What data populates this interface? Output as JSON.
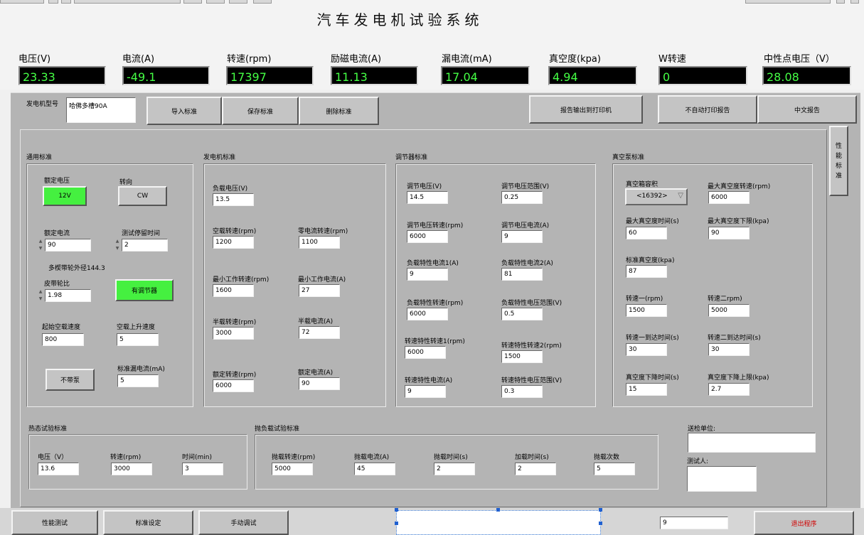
{
  "app": {
    "title": "汽车发电机试验系统"
  },
  "meters": [
    {
      "label": "电压(V)",
      "value": "23.33"
    },
    {
      "label": "电流(A)",
      "value": "-49.1"
    },
    {
      "label": "转速(rpm)",
      "value": "17397"
    },
    {
      "label": "励磁电流(A)",
      "value": "11.13"
    },
    {
      "label": "漏电流(mA)",
      "value": "17.04"
    },
    {
      "label": "真空度(kpa)",
      "value": "4.94"
    },
    {
      "label": "W转速",
      "value": "0"
    },
    {
      "label": "中性点电压（V）",
      "value": "28.08"
    }
  ],
  "model": {
    "label": "发电机型号",
    "value": "哈佛多槽90A"
  },
  "toolbar": {
    "import": "导入标准",
    "save": "保存标准",
    "delete": "删除标准",
    "print_report": "报告输出到打印机",
    "auto_print": "不自动打印报告",
    "chinese_report": "中文报告"
  },
  "side_tab": "性能标准",
  "general": {
    "title": "通用标准",
    "rated_voltage_label": "额定电压",
    "rated_voltage_btn": "12V",
    "direction_label": "转向",
    "direction_btn": "CW",
    "rated_current_label": "额定电流",
    "rated_current": "90",
    "dwell_label": "测试停留时间",
    "dwell": "2",
    "pulley_note": "多楔带轮外径144.3",
    "belt_ratio_label": "皮带轮比",
    "belt_ratio": "1.98",
    "regulator_btn": "有调节器",
    "start_speed_label": "起始空载速度",
    "start_speed": "800",
    "rise_speed_label": "空载上升速度",
    "rise_speed": "5",
    "pump_btn": "不带泵",
    "leak_label": "标准漏电流(mA)",
    "leak": "5"
  },
  "generator": {
    "title": "发电机标准",
    "load_voltage_label": "负载电压(V)",
    "load_voltage": "13.5",
    "idle_speed_label": "空载转速(rpm)",
    "idle_speed": "1200",
    "zero_speed_label": "零电流转速(rpm)",
    "zero_speed": "1100",
    "min_speed_label": "最小工作转速(rpm)",
    "min_speed": "1600",
    "min_current_label": "最小工作电流(A)",
    "min_current": "27",
    "half_speed_label": "半载转速(rpm)",
    "half_speed": "3000",
    "half_current_label": "半载电流(A)",
    "half_current": "72",
    "rated_speed_label": "额定转速(rpm)",
    "rated_speed": "6000",
    "rated_current_label": "额定电流(A)",
    "rated_current": "90"
  },
  "regulator": {
    "title": "调节器标准",
    "reg_voltage_label": "调节电压(V)",
    "reg_voltage": "14.5",
    "reg_range_label": "调节电压范围(V)",
    "reg_range": "0.25",
    "reg_speed_label": "调节电压转速(rpm)",
    "reg_speed": "6000",
    "reg_current_label": "调节电压电流(A)",
    "reg_current": "9",
    "load_cur1_label": "负载特性电流1(A)",
    "load_cur1": "9",
    "load_cur2_label": "负载特性电流2(A)",
    "load_cur2": "81",
    "load_speed_label": "负载特性转速(rpm)",
    "load_speed": "6000",
    "load_vrange_label": "负载特性电压范围(V)",
    "load_vrange": "0.5",
    "spd_speed1_label": "转速特性转速1(rpm)",
    "spd_speed1": "6000",
    "spd_speed2_label": "转速特性转速2(rpm)",
    "spd_speed2": "1500",
    "spd_current_label": "转速特性电流(A)",
    "spd_current": "9",
    "spd_vrange_label": "转速特性电压范围(V)",
    "spd_vrange": "0.3"
  },
  "vacuum": {
    "title": "真空泵标准",
    "volume_label": "真空箱容积",
    "volume": "<16392>",
    "max_speed_label": "最大真空度转速(rpm)",
    "max_speed": "6000",
    "max_time_label": "最大真空度时间(s)",
    "max_time": "60",
    "max_low_label": "最大真空度下限(kpa)",
    "max_low": "90",
    "std_label": "标准真空度(kpa)",
    "std": "87",
    "speed1_label": "转速一(rpm)",
    "speed1": "1500",
    "speed2_label": "转速二rpm)",
    "speed2": "5000",
    "time1_label": "转速一到达时间(s)",
    "time1": "30",
    "time2_label": "转速二到达时间(s)",
    "time2": "30",
    "drop_time_label": "真空度下降时间(s)",
    "drop_time": "15",
    "drop_up_label": "真空度下降上限(kpa)",
    "drop_up": "2.7"
  },
  "thermal": {
    "title": "热态试验标准",
    "voltage_label": "电压（V）",
    "voltage": "13.6",
    "speed_label": "转速(rpm)",
    "speed": "3000",
    "time_label": "时间(min)",
    "time": "3"
  },
  "dump": {
    "title": "抛负载试验标准",
    "speed_label": "抛载转速(rpm)",
    "speed": "5000",
    "current_label": "抛载电流(A)",
    "current": "45",
    "time_label": "抛载时间(s)",
    "time": "2",
    "add_time_label": "加载时间(s)",
    "add_time": "2",
    "count_label": "抛载次数",
    "count": "5"
  },
  "inspection": {
    "unit_label": "送检单位:",
    "unit": "",
    "tester_label": "测试人:",
    "tester": ""
  },
  "bottom": {
    "perf_test": "性能测试",
    "std_setting": "标准设定",
    "manual_debug": "手动调试",
    "counter": "9",
    "exit": "退出程序"
  }
}
